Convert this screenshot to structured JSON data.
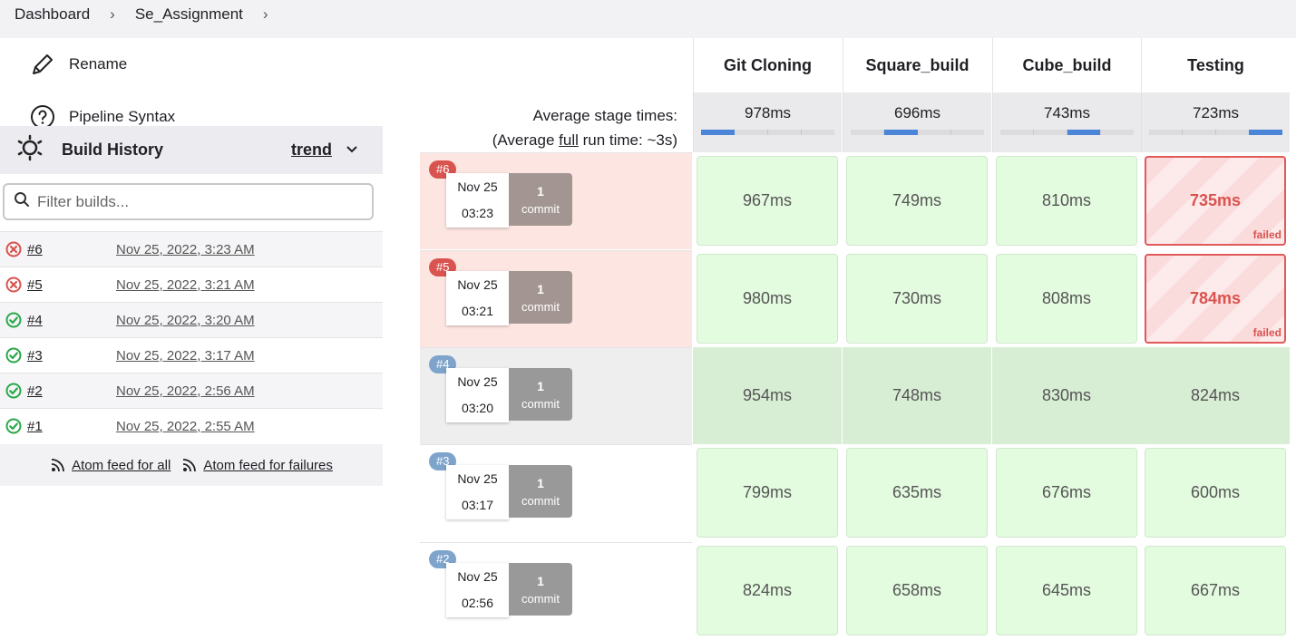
{
  "breadcrumb": {
    "items": [
      "Dashboard",
      "Se_Assignment"
    ]
  },
  "sidebar": {
    "tasks": [
      {
        "label": "Rename",
        "icon": "pencil-icon"
      },
      {
        "label": "Pipeline Syntax",
        "icon": "help-icon"
      }
    ]
  },
  "build_history": {
    "title": "Build History",
    "trend_label": "trend",
    "filter_placeholder": "Filter builds...",
    "builds": [
      {
        "number": "#6",
        "date": "Nov 25, 2022, 3:23 AM",
        "status": "failed"
      },
      {
        "number": "#5",
        "date": "Nov 25, 2022, 3:21 AM",
        "status": "failed"
      },
      {
        "number": "#4",
        "date": "Nov 25, 2022, 3:20 AM",
        "status": "success"
      },
      {
        "number": "#3",
        "date": "Nov 25, 2022, 3:17 AM",
        "status": "success"
      },
      {
        "number": "#2",
        "date": "Nov 25, 2022, 2:56 AM",
        "status": "success"
      },
      {
        "number": "#1",
        "date": "Nov 25, 2022, 2:55 AM",
        "status": "success"
      }
    ],
    "feed_all": "Atom feed for all",
    "feed_failures": "Atom feed for failures"
  },
  "stage_view": {
    "avg_label_line1": "Average stage times:",
    "avg_label_prefix": "(Average ",
    "avg_label_link": "full",
    "avg_label_suffix": " run time: ~3s)",
    "stages": [
      {
        "name": "Git Cloning",
        "avg": "978ms",
        "fill_segment": 0
      },
      {
        "name": "Square_build",
        "avg": "696ms",
        "fill_segment": 1
      },
      {
        "name": "Cube_build",
        "avg": "743ms",
        "fill_segment": 2
      },
      {
        "name": "Testing",
        "avg": "723ms",
        "fill_segment": 3
      }
    ],
    "runs": [
      {
        "badge": "#6",
        "date": "Nov 25",
        "time": "03:23",
        "commits": "1",
        "commit_label": "commit",
        "status": "failed",
        "cells": [
          "967ms",
          "749ms",
          "810ms",
          "735ms"
        ],
        "failed_index": 3
      },
      {
        "badge": "#5",
        "date": "Nov 25",
        "time": "03:21",
        "commits": "1",
        "commit_label": "commit",
        "status": "failed",
        "cells": [
          "980ms",
          "730ms",
          "808ms",
          "784ms"
        ],
        "failed_index": 3
      },
      {
        "badge": "#4",
        "date": "Nov 25",
        "time": "03:20",
        "commits": "1",
        "commit_label": "commit",
        "status": "selected",
        "cells": [
          "954ms",
          "748ms",
          "830ms",
          "824ms"
        ],
        "failed_index": -1
      },
      {
        "badge": "#3",
        "date": "Nov 25",
        "time": "03:17",
        "commits": "1",
        "commit_label": "commit",
        "status": "success",
        "cells": [
          "799ms",
          "635ms",
          "676ms",
          "600ms"
        ],
        "failed_index": -1
      },
      {
        "badge": "#2",
        "date": "Nov 25",
        "time": "02:56",
        "commits": "1",
        "commit_label": "commit",
        "status": "success",
        "cells": [
          "824ms",
          "658ms",
          "645ms",
          "667ms"
        ],
        "failed_index": -1
      }
    ],
    "failed_tag": "failed"
  },
  "colors": {
    "success": "#2aa84a",
    "failure": "#d9534f",
    "accent": "#4a85d8"
  }
}
